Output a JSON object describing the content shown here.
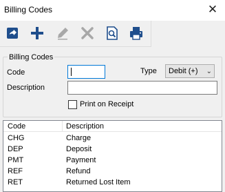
{
  "window": {
    "title": "Billing Codes",
    "close_glyph": "✕"
  },
  "toolbar": {
    "buttons": [
      {
        "name": "open-icon",
        "enabled": true
      },
      {
        "name": "add-icon",
        "enabled": true
      },
      {
        "name": "edit-icon",
        "enabled": false
      },
      {
        "name": "delete-icon",
        "enabled": false
      },
      {
        "name": "print-preview-icon",
        "enabled": true
      },
      {
        "name": "print-icon",
        "enabled": true
      }
    ]
  },
  "form": {
    "group_label": "Billing Codes",
    "code_label": "Code",
    "code_value": "",
    "type_label": "Type",
    "type_value": "Debit (+)",
    "description_label": "Description",
    "description_value": "",
    "print_on_receipt_label": "Print on Receipt",
    "print_on_receipt_checked": false
  },
  "list": {
    "columns": [
      "Code",
      "Description"
    ],
    "rows": [
      {
        "code": "CHG",
        "description": "Charge"
      },
      {
        "code": "DEP",
        "description": "Deposit"
      },
      {
        "code": "PMT",
        "description": "Payment"
      },
      {
        "code": "REF",
        "description": "Refund"
      },
      {
        "code": "RET",
        "description": "Returned Lost Item"
      }
    ]
  },
  "colors": {
    "accent": "#0078d7",
    "icon_blue": "#1f4e8c",
    "icon_disabled": "#a8a8a8",
    "icon_dark": "#2b2b2b"
  }
}
